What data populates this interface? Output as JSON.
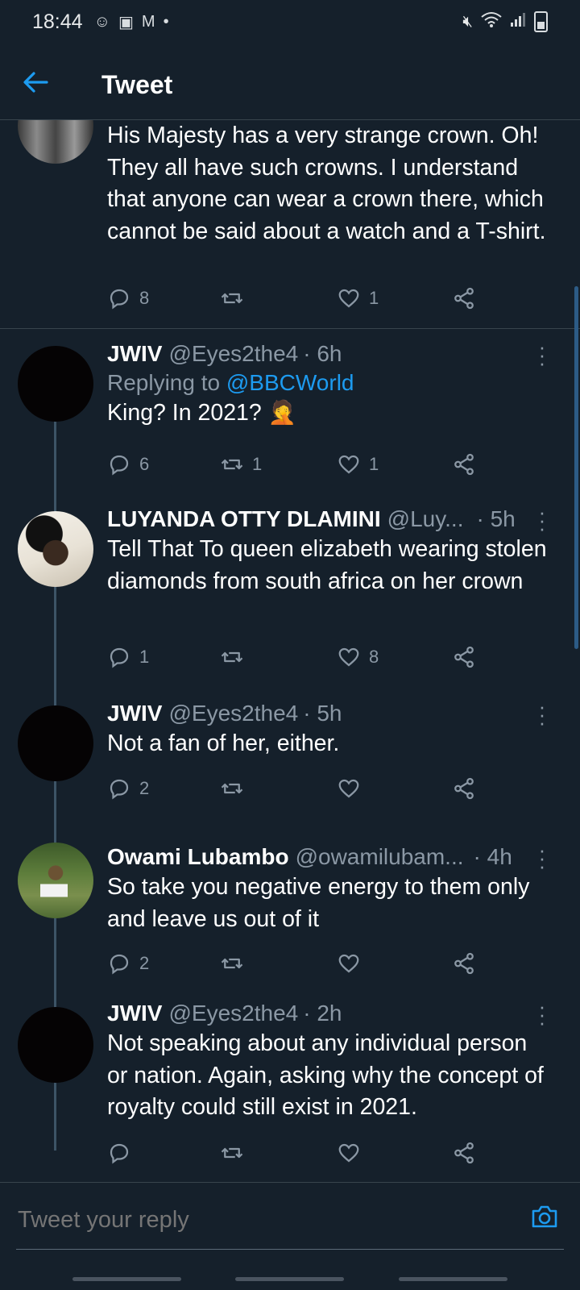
{
  "status_bar": {
    "time": "18:44",
    "icons_left": [
      "reddit-icon",
      "gallery-icon",
      "gmail-icon",
      "dot-icon"
    ],
    "icons_right": [
      "mute-icon",
      "wifi-icon",
      "signal-icon",
      "battery-icon"
    ]
  },
  "header": {
    "title": "Tweet"
  },
  "tweets": [
    {
      "text": "His Majesty has a very strange crown. Oh! They all have such crowns. I understand that anyone can wear a crown there, which cannot be said about a watch and a T-shirt.",
      "reply_count": "8",
      "retweet_count": "",
      "like_count": "1"
    },
    {
      "name": "JWIV",
      "handle": "@Eyes2the4",
      "time": "· 6h",
      "replying_prefix": "Replying to",
      "replying_to": "@BBCWorld",
      "text": "King? In 2021? 🤦",
      "reply_count": "6",
      "retweet_count": "1",
      "like_count": "1"
    },
    {
      "name": "LUYANDA OTTY DLAMINI",
      "handle": "@Luy...",
      "time": "· 5h",
      "text": "Tell That To queen elizabeth wearing stolen diamonds from south africa on her crown",
      "reply_count": "1",
      "retweet_count": "",
      "like_count": "8"
    },
    {
      "name": "JWIV",
      "handle": "@Eyes2the4",
      "time": "· 5h",
      "text": "Not a fan of her, either.",
      "reply_count": "2",
      "retweet_count": "",
      "like_count": ""
    },
    {
      "name": "Owami Lubambo",
      "handle": "@owamilubam...",
      "time": "· 4h",
      "text": "So take you negative energy to them only and leave us out of it",
      "reply_count": "2",
      "retweet_count": "",
      "like_count": ""
    },
    {
      "name": "JWIV",
      "handle": "@Eyes2the4",
      "time": "· 2h",
      "text": "Not speaking about any individual person or nation. Again, asking why the concept of royalty could still exist in 2021.",
      "reply_count": "",
      "retweet_count": "",
      "like_count": ""
    }
  ],
  "reply_bar": {
    "placeholder": "Tweet your reply"
  },
  "colors": {
    "background": "#15202b",
    "accent": "#1d9bf0",
    "muted": "#8b98a5",
    "divider": "#38444d"
  }
}
